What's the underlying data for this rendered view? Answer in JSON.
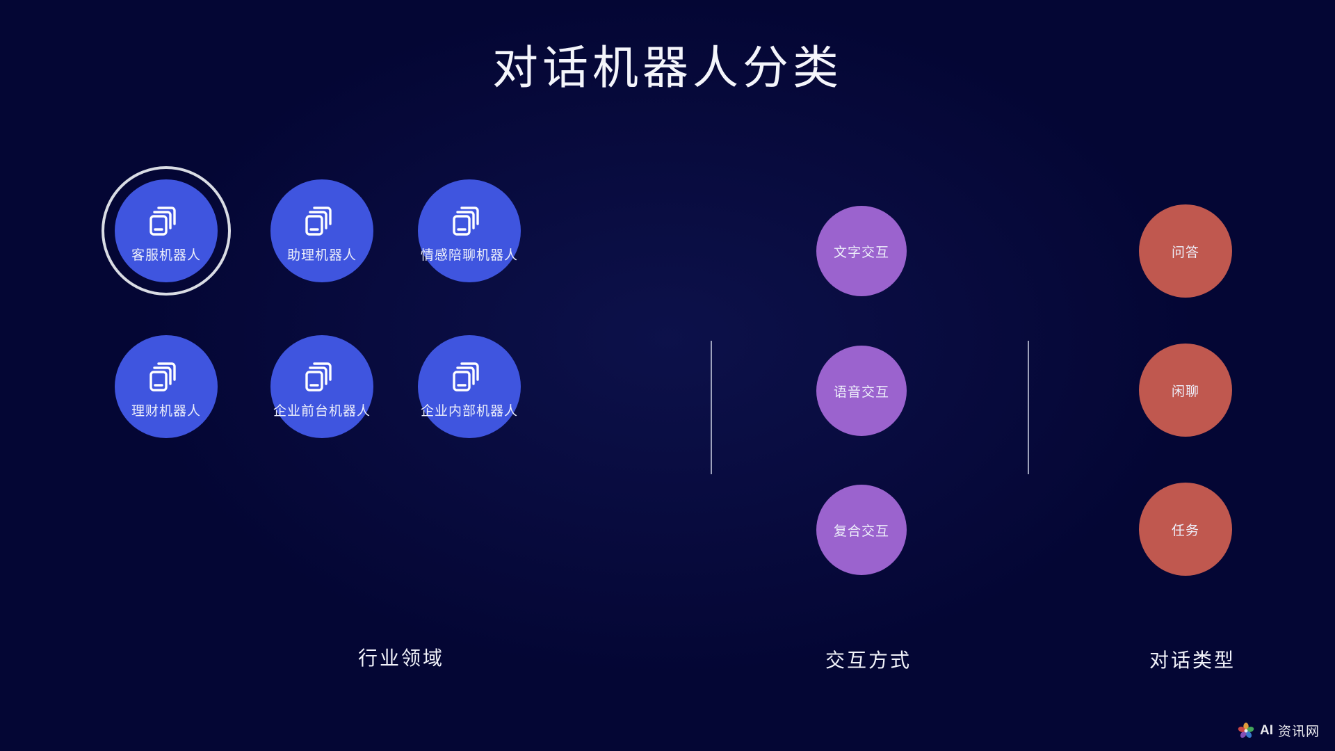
{
  "slide": {
    "title": "对话机器人分类",
    "background_color": "#040634"
  },
  "columns": [
    {
      "key": "industry",
      "caption": "行业领域",
      "accent_color": "#3F55DF",
      "icon": "stacked-windows-icon",
      "nodes": [
        {
          "label": "客服机器人",
          "selected": true
        },
        {
          "label": "助理机器人",
          "selected": false
        },
        {
          "label": "情感陪聊机器人",
          "selected": false
        },
        {
          "label": "理财机器人",
          "selected": false
        },
        {
          "label": "企业前台机器人",
          "selected": false
        },
        {
          "label": "企业内部机器人",
          "selected": false
        }
      ]
    },
    {
      "key": "interaction",
      "caption": "交互方式",
      "accent_color": "#9B63CE",
      "nodes": [
        {
          "label": "文字交互"
        },
        {
          "label": "语音交互"
        },
        {
          "label": "复合交互"
        }
      ]
    },
    {
      "key": "dialogue",
      "caption": "对话类型",
      "accent_color": "#C0584F",
      "nodes": [
        {
          "label": "问答"
        },
        {
          "label": "闲聊"
        },
        {
          "label": "任务"
        }
      ]
    }
  ],
  "dividers": [
    {
      "name": "divider-industry-interaction"
    },
    {
      "name": "divider-interaction-dialogue"
    }
  ],
  "watermark": {
    "brand": "AI",
    "text": "资讯网"
  }
}
